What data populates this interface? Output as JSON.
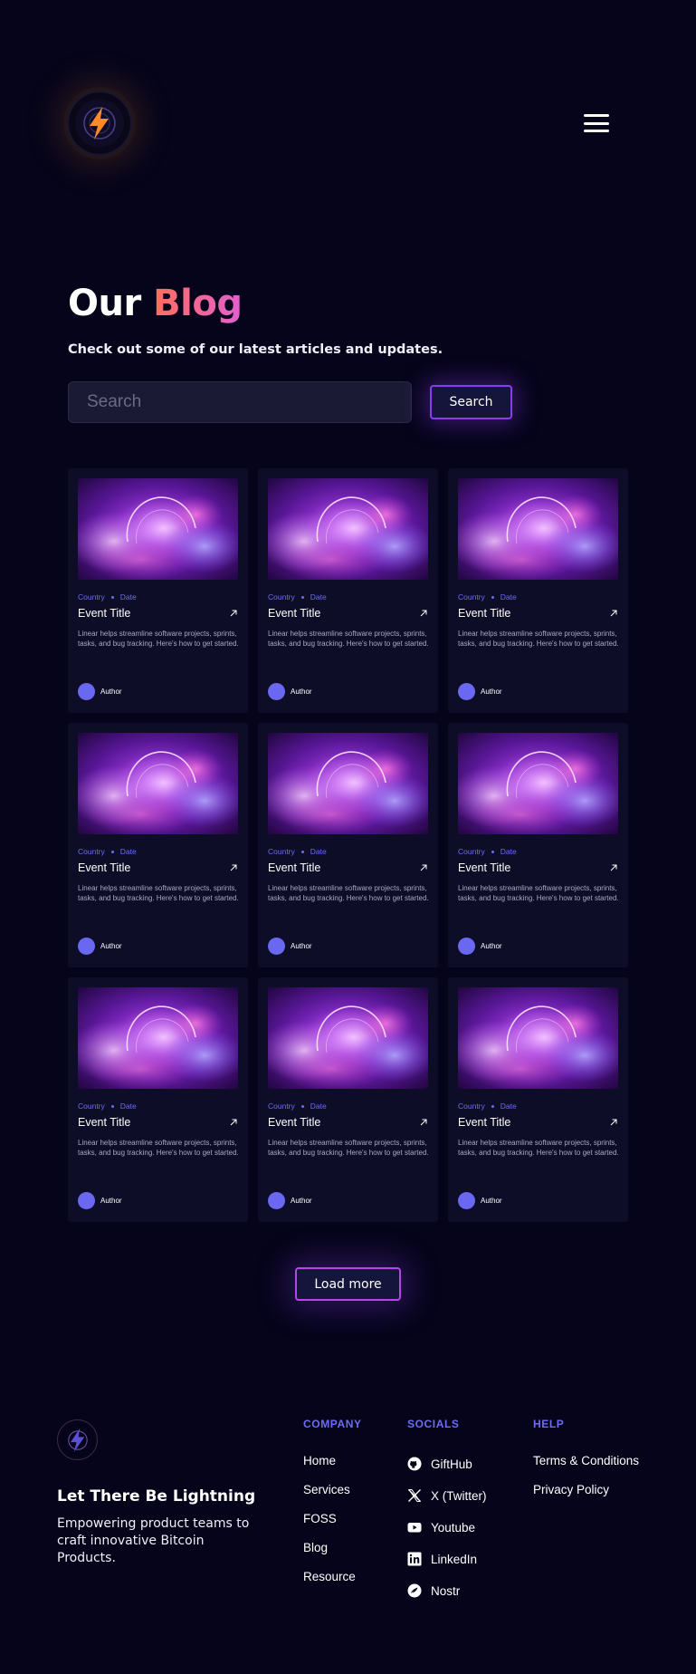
{
  "header": {
    "logo_icon": "lightning-bolt-icon",
    "menu_icon": "hamburger-menu-icon"
  },
  "hero": {
    "title_main": "Our",
    "title_accent": "Blog",
    "subtitle": "Check out some of our latest articles and updates.",
    "search_placeholder": "Search",
    "search_button": "Search"
  },
  "cards": [
    {
      "country": "Country",
      "date": "Date",
      "title": "Event Title",
      "desc": "Linear helps streamline software projects, sprints, tasks, and bug tracking. Here's how to get started.",
      "author": "Author"
    },
    {
      "country": "Country",
      "date": "Date",
      "title": "Event Title",
      "desc": "Linear helps streamline software projects, sprints, tasks, and bug tracking. Here's how to get started.",
      "author": "Author"
    },
    {
      "country": "Country",
      "date": "Date",
      "title": "Event Title",
      "desc": "Linear helps streamline software projects, sprints, tasks, and bug tracking. Here's how to get started.",
      "author": "Author"
    },
    {
      "country": "Country",
      "date": "Date",
      "title": "Event Title",
      "desc": "Linear helps streamline software projects, sprints, tasks, and bug tracking. Here's how to get started.",
      "author": "Author"
    },
    {
      "country": "Country",
      "date": "Date",
      "title": "Event Title",
      "desc": "Linear helps streamline software projects, sprints, tasks, and bug tracking. Here's how to get started.",
      "author": "Author"
    },
    {
      "country": "Country",
      "date": "Date",
      "title": "Event Title",
      "desc": "Linear helps streamline software projects, sprints, tasks, and bug tracking. Here's how to get started.",
      "author": "Author"
    },
    {
      "country": "Country",
      "date": "Date",
      "title": "Event Title",
      "desc": "Linear helps streamline software projects, sprints, tasks, and bug tracking. Here's how to get started.",
      "author": "Author"
    },
    {
      "country": "Country",
      "date": "Date",
      "title": "Event Title",
      "desc": "Linear helps streamline software projects, sprints, tasks, and bug tracking. Here's how to get started.",
      "author": "Author"
    },
    {
      "country": "Country",
      "date": "Date",
      "title": "Event Title",
      "desc": "Linear helps streamline software projects, sprints, tasks, and bug tracking. Here's how to get started.",
      "author": "Author"
    }
  ],
  "load_more": "Load more",
  "footer": {
    "tagline": "Let There Be Lightning",
    "description": "Empowering product teams to craft innovative Bitcoin Products.",
    "company": {
      "heading": "COMPANY",
      "links": [
        "Home",
        "Services",
        "FOSS",
        "Blog",
        "Resource"
      ]
    },
    "socials": {
      "heading": "SOCIALS",
      "links": [
        {
          "label": "GiftHub",
          "icon": "github-icon"
        },
        {
          "label": "X (Twitter)",
          "icon": "x-twitter-icon"
        },
        {
          "label": "Youtube",
          "icon": "youtube-icon"
        },
        {
          "label": "LinkedIn",
          "icon": "linkedin-icon"
        },
        {
          "label": "Nostr",
          "icon": "nostr-icon"
        }
      ]
    },
    "help": {
      "heading": "HELP",
      "links": [
        "Terms & Conditions",
        "Privacy Policy"
      ]
    }
  },
  "colors": {
    "background": "#05041a",
    "accent_blue": "#6c6cf5",
    "accent_purple": "#8b3cf0",
    "accent_gradient_start": "#ff6f5b",
    "accent_gradient_end": "#e25fd0",
    "logo_orange": "#ff8a2b"
  }
}
